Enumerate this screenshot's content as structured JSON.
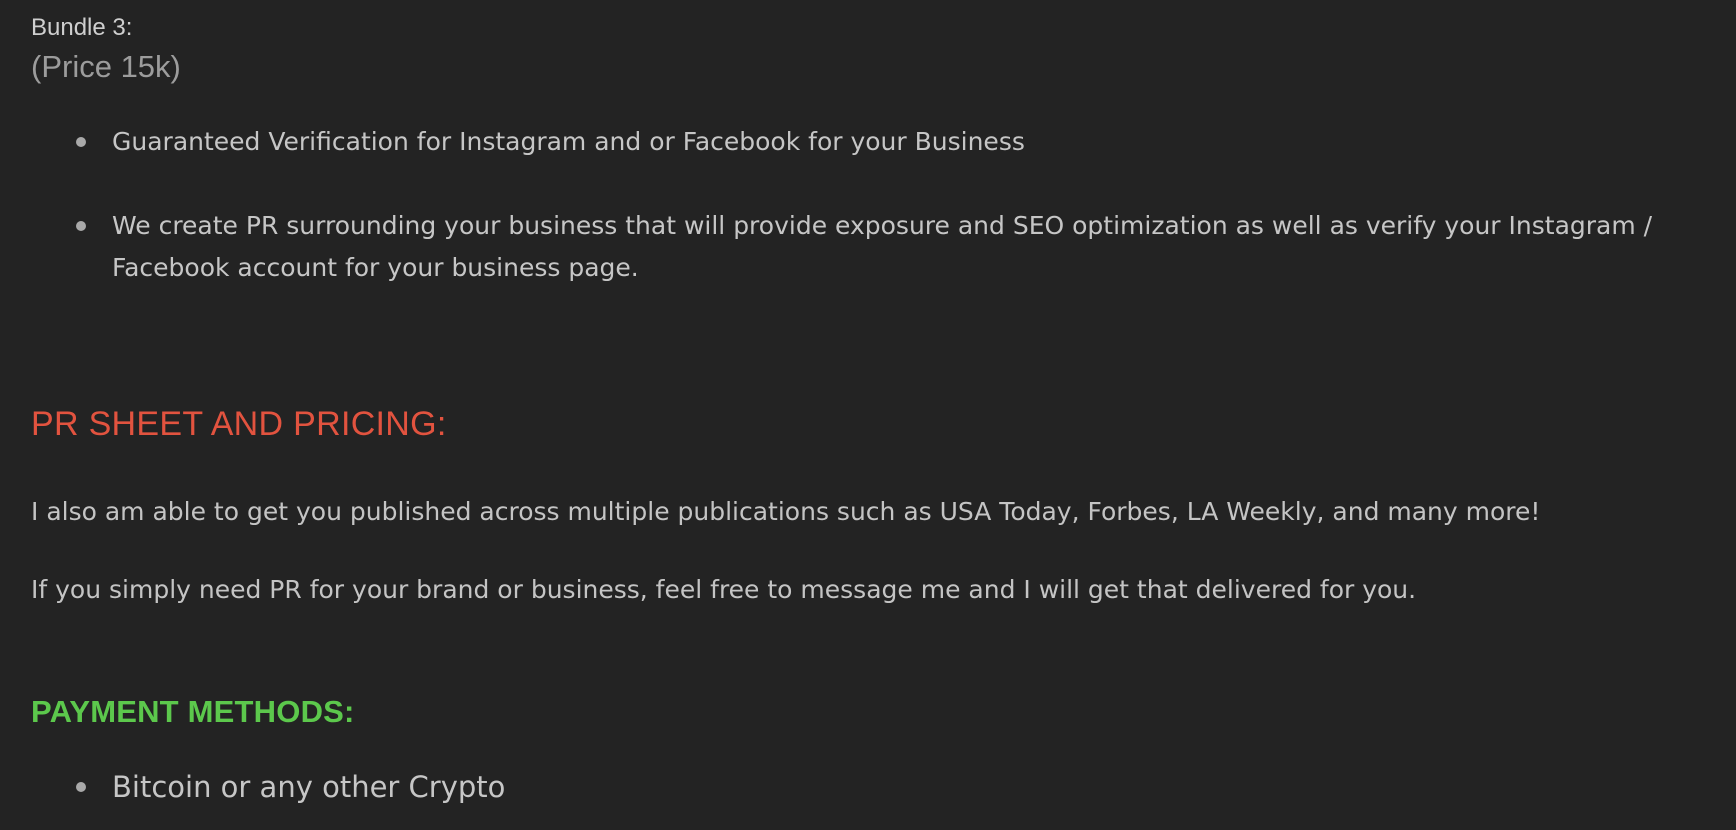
{
  "bundle": {
    "label": "Bundle 3:",
    "price": "(Price 15k)",
    "items": [
      "Guaranteed Verification for Instagram and or Facebook for your Business",
      "We create PR surrounding your business that will provide exposure and SEO optimization as well as verify your Instagram / Facebook account for your business page."
    ]
  },
  "pr_section": {
    "heading": "PR SHEET AND PRICING:",
    "heading_color": "#e2533f",
    "paragraphs": [
      "I also am able to get you published across multiple publications such as USA Today, Forbes, LA Weekly, and many more!",
      "If you simply need PR for your brand or business, feel free to message me and I will get that delivered for you."
    ]
  },
  "payment": {
    "heading": "PAYMENT METHODS:",
    "heading_color": "#5cc84c",
    "items": [
      "Bitcoin or any other Crypto"
    ]
  },
  "theme": {
    "background": "#232323",
    "text": "#c9c9c9"
  }
}
